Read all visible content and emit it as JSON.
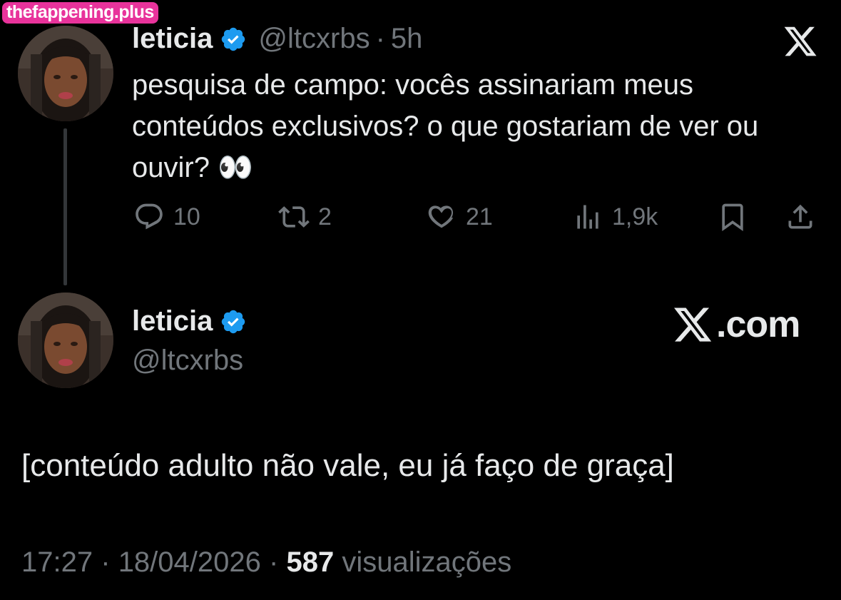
{
  "watermark": "thefappening.plus",
  "colors": {
    "background": "#000000",
    "text": "#e7e9ea",
    "muted": "#71767b",
    "verified": "#1d9bf0",
    "watermark": "#e8339b"
  },
  "quoted_tweet": {
    "display_name": "leticia",
    "handle": "@ltcxrbs",
    "separator": "·",
    "time": "5h",
    "text": "pesquisa de campo: vocês assinariam meus conteúdos exclusivos? o que gostariam de ver ou ouvir? 👀",
    "actions": {
      "replies": "10",
      "reposts": "2",
      "likes": "21",
      "views": "1,9k"
    },
    "icons": [
      "reply-icon",
      "repost-icon",
      "like-icon",
      "views-icon",
      "bookmark-icon",
      "share-icon",
      "x-logo-icon"
    ]
  },
  "main_tweet": {
    "display_name": "leticia",
    "handle": "@ltcxrbs",
    "brand": ".com",
    "text": "[conteúdo adulto não vale, eu já faço de graça]",
    "time": "17:27",
    "date": "18/04/2026",
    "separator": "·",
    "views_count": "587",
    "views_label": "visualizações"
  }
}
